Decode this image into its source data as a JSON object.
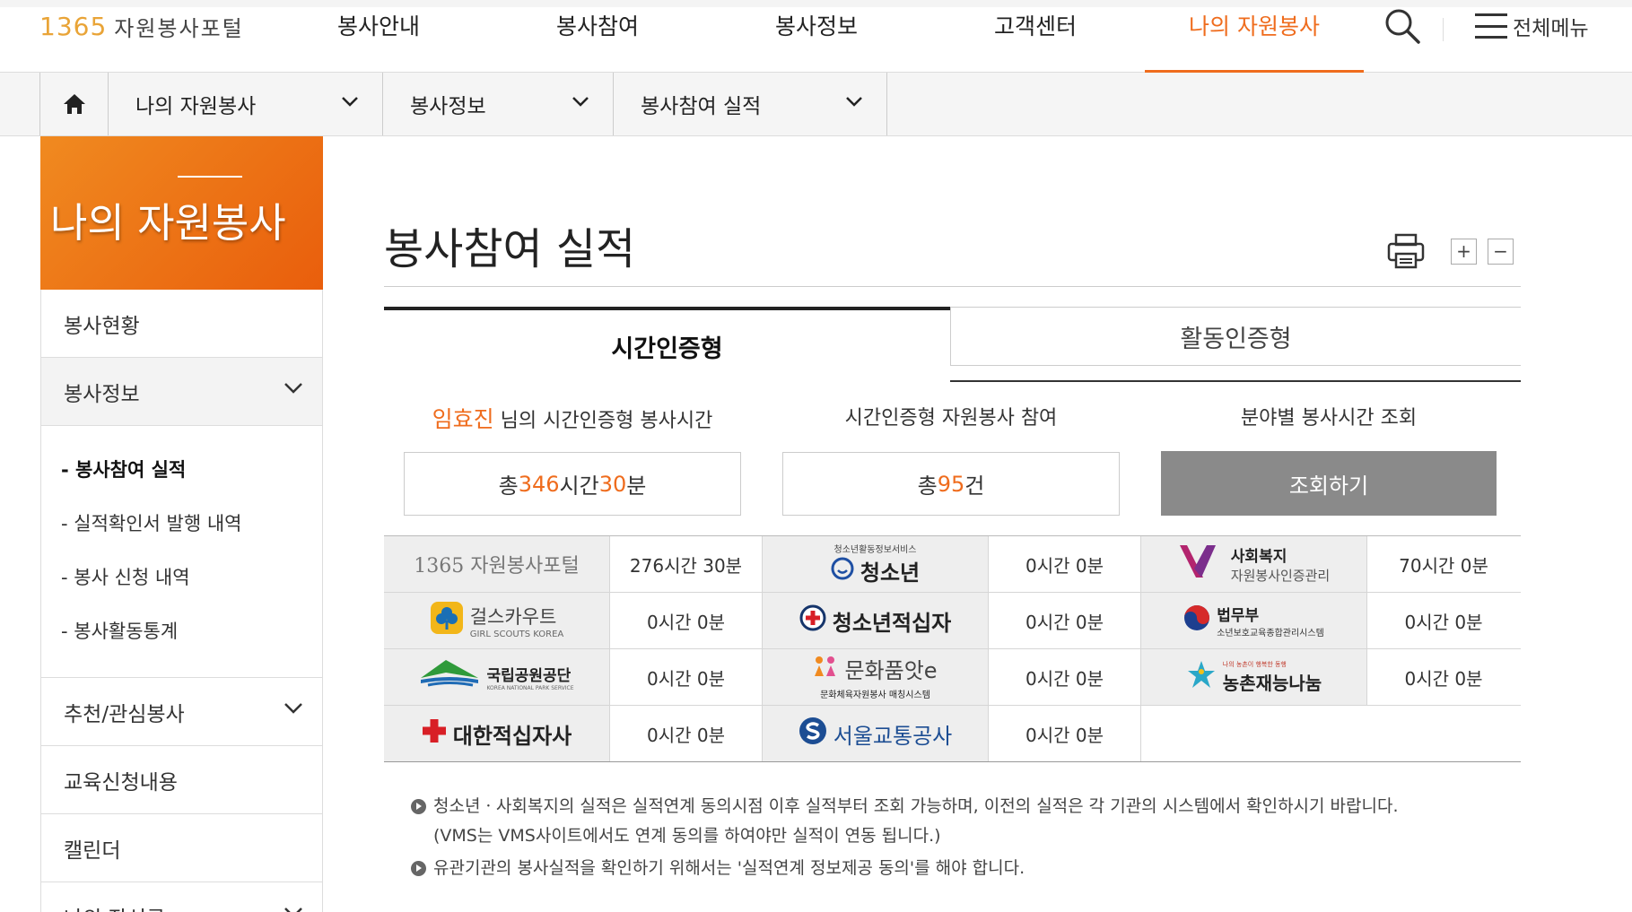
{
  "header": {
    "logo_number": "1365",
    "logo_text": "자원봉사포털",
    "nav": [
      "봉사안내",
      "봉사참여",
      "봉사정보",
      "고객센터",
      "나의 자원봉사"
    ],
    "active_nav": "나의 자원봉사",
    "all_menu_label": "전체메뉴"
  },
  "breadcrumb": {
    "items": [
      "나의 자원봉사",
      "봉사정보",
      "봉사참여 실적"
    ]
  },
  "sidebar": {
    "title": "나의 자원봉사",
    "items": [
      {
        "label": "봉사현황"
      },
      {
        "label": "봉사정보",
        "open": true
      },
      {
        "label": "추천/관심봉사"
      },
      {
        "label": "교육신청내용"
      },
      {
        "label": "캘린더"
      },
      {
        "label": "나의 작성글"
      }
    ],
    "sub_items": [
      "- 봉사참여 실적",
      "- 실적확인서 발행 내역",
      "- 봉사 신청 내역",
      "- 봉사활동통계"
    ]
  },
  "main": {
    "page_title": "봉사참여 실적",
    "zoom_in": "+",
    "zoom_out": "−",
    "tabs": [
      "시간인증형",
      "활동인증형"
    ],
    "summary": {
      "user_name": "임효진",
      "hours_label_suffix": " 님의 시간인증형 봉사시간",
      "hours_prefix": "총 ",
      "hours": "346",
      "hours_unit": "시간 ",
      "minutes": "30",
      "minutes_unit": "분",
      "count_label": "시간인증형 자원봉사 참여",
      "count_prefix": "총 ",
      "count": "95",
      "count_unit": "건",
      "field_label": "분야별 봉사시간 조회",
      "field_button": "조회하기"
    },
    "institutions": [
      {
        "name": "1365 자원봉사포털",
        "value": "276시간 30분"
      },
      {
        "name": "청소년",
        "sub": "청소년활동정보서비스",
        "value": "0시간 0분"
      },
      {
        "name": "사회복지",
        "sub": "자원봉사인증관리",
        "value": "70시간 0분"
      },
      {
        "name": "걸스카우트",
        "sub": "GIRL SCOUTS KOREA",
        "value": "0시간 0분"
      },
      {
        "name": "청소년적십자",
        "value": "0시간 0분"
      },
      {
        "name": "법무부",
        "sub": "소년보호교육종합관리시스템",
        "value": "0시간 0분"
      },
      {
        "name": "국립공원공단",
        "sub": "KOREA NATIONAL PARK SERVICE",
        "value": "0시간 0분"
      },
      {
        "name": "문화품앗e",
        "sub": "문화체육자원봉사 매칭시스템",
        "value": "0시간 0분"
      },
      {
        "name": "농촌재능나눔",
        "sub": "나의 농촌이 행복한 동행",
        "value": "0시간 0분"
      },
      {
        "name": "대한적십자사",
        "value": "0시간 0분"
      },
      {
        "name": "서울교통공사",
        "value": "0시간 0분"
      }
    ],
    "notes": [
      "청소년ㆍ사회복지의 실적은 실적연계 동의시점 이후 실적부터 조회 가능하며, 이전의 실적은 각 기관의 시스템에서 확인하시기 바랍니다.",
      "(VMS는 VMS사이트에서도 연계 동의를 하여야만 실적이 연동 됩니다.)",
      "유관기관의 봉사실적을 확인하기 위해서는 '실적연계 정보제공 동의'를 해야 합니다."
    ]
  },
  "colors": {
    "accent": "#ef6c1d",
    "button_gray": "#8a8a8a",
    "logo_orange": "#e9a437"
  }
}
